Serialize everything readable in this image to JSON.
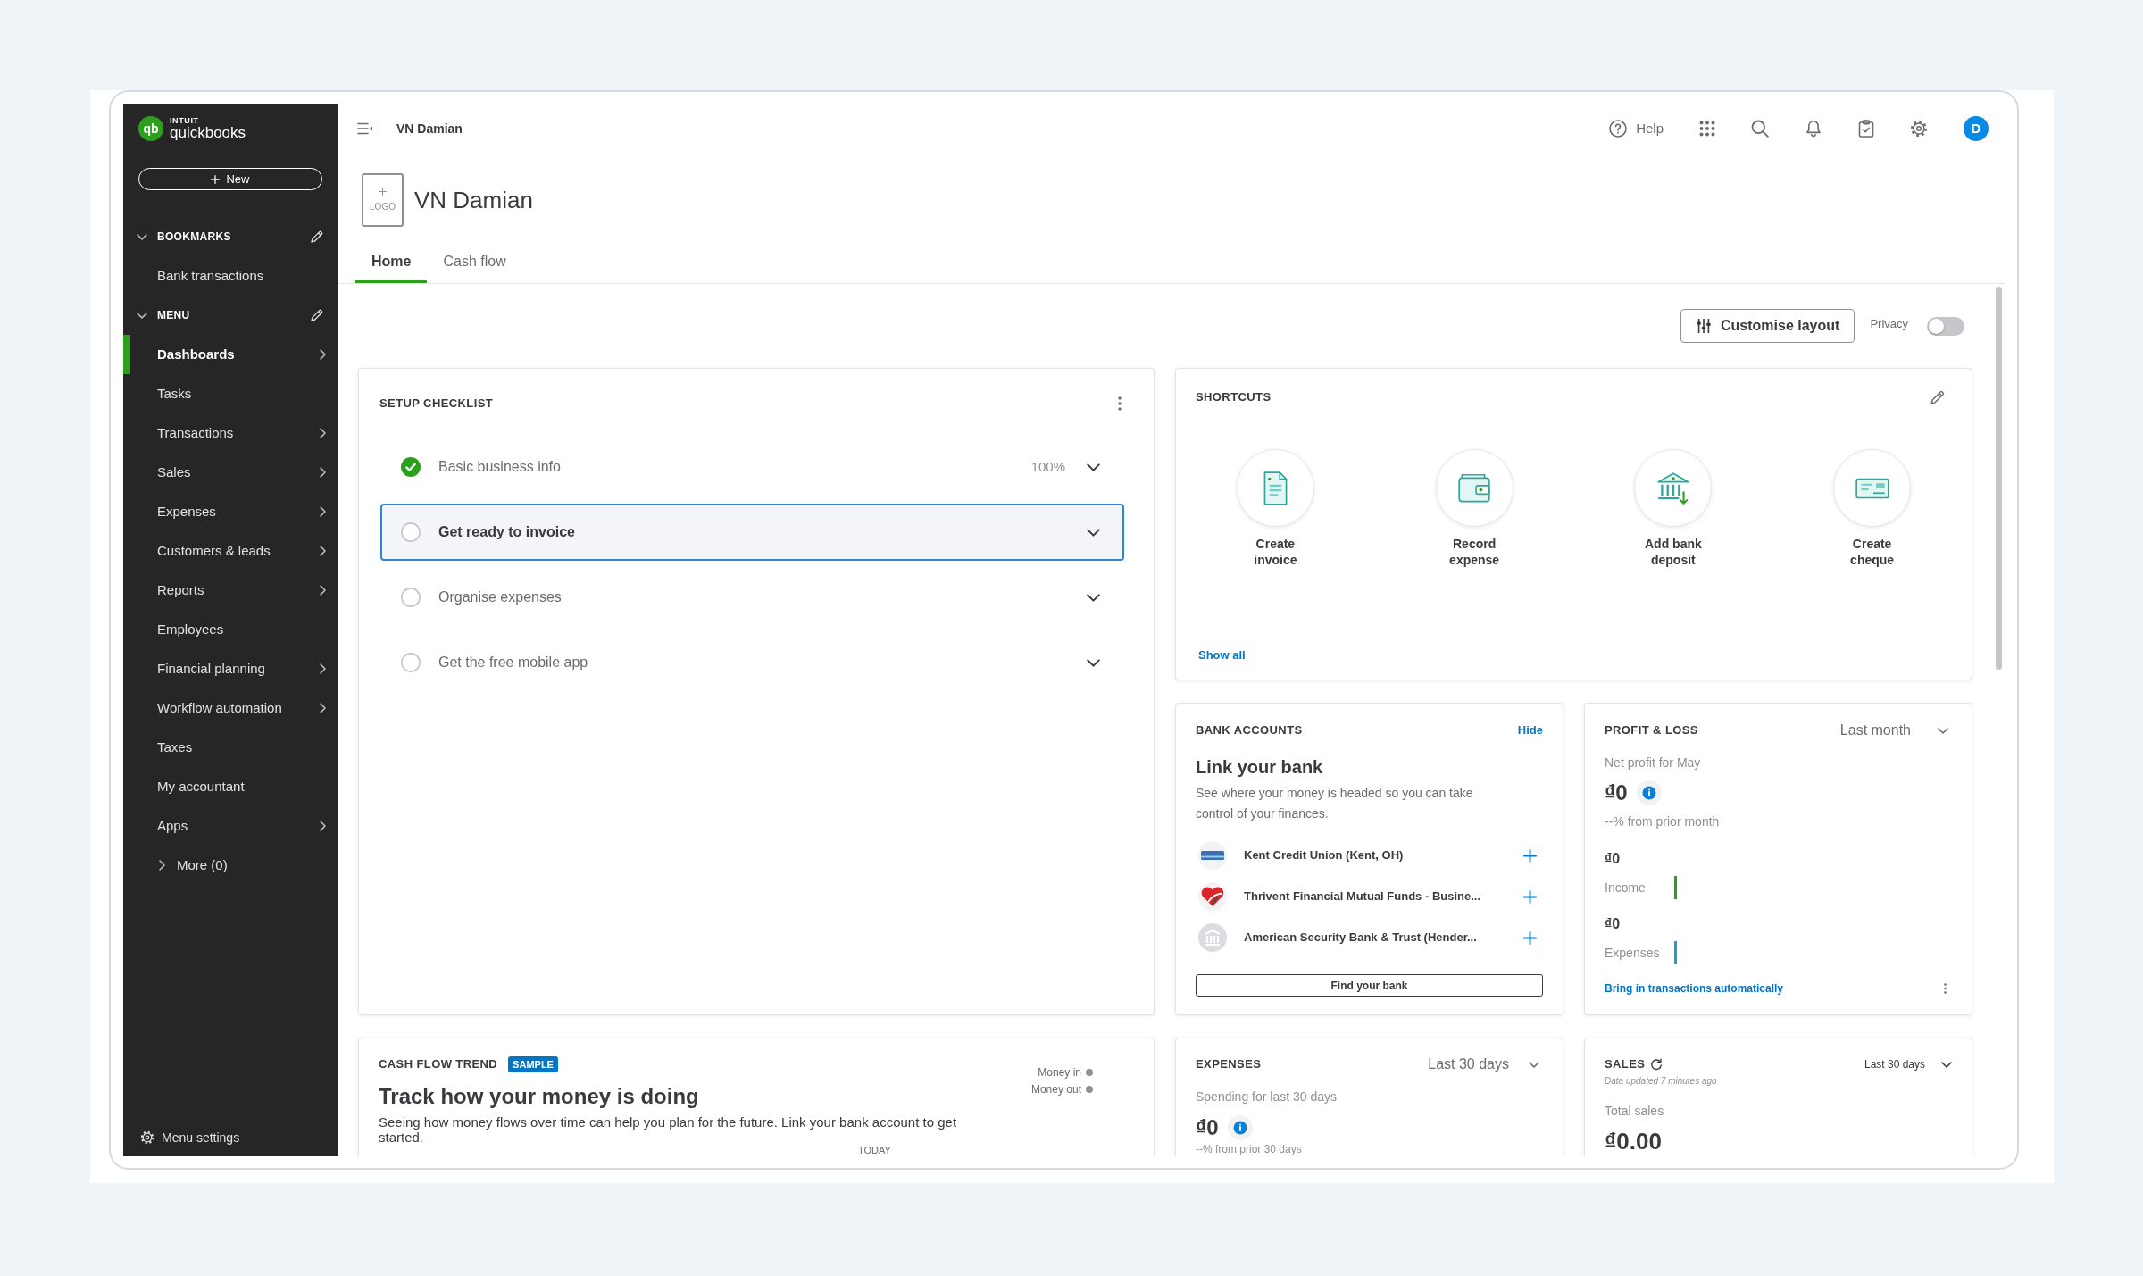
{
  "sidebar": {
    "brand": {
      "mark": "qb",
      "company": "INTUIT",
      "product": "quickbooks"
    },
    "new_button": "New",
    "sections": [
      {
        "label": "BOOKMARKS",
        "expanded": true,
        "items": [
          {
            "label": "Bank transactions",
            "selected": false,
            "submenu": false
          }
        ]
      },
      {
        "label": "MENU",
        "expanded": true,
        "items": [
          {
            "label": "Dashboards",
            "selected": true,
            "submenu": true
          },
          {
            "label": "Tasks",
            "selected": false,
            "submenu": false
          },
          {
            "label": "Transactions",
            "selected": false,
            "submenu": true
          },
          {
            "label": "Sales",
            "selected": false,
            "submenu": true
          },
          {
            "label": "Expenses",
            "selected": false,
            "submenu": true
          },
          {
            "label": "Customers & leads",
            "selected": false,
            "submenu": true
          },
          {
            "label": "Reports",
            "selected": false,
            "submenu": true
          },
          {
            "label": "Employees",
            "selected": false,
            "submenu": false
          },
          {
            "label": "Financial planning",
            "selected": false,
            "submenu": true
          },
          {
            "label": "Workflow automation",
            "selected": false,
            "submenu": true
          },
          {
            "label": "Taxes",
            "selected": false,
            "submenu": false
          },
          {
            "label": "My accountant",
            "selected": false,
            "submenu": false
          },
          {
            "label": "Apps",
            "selected": false,
            "submenu": true
          }
        ]
      }
    ],
    "more": {
      "label": "More (0)",
      "expanded": false
    },
    "settings": "Menu settings"
  },
  "header": {
    "company": "VN Damian",
    "help": "Help",
    "avatar": "D"
  },
  "page": {
    "logo_button": "LOGO",
    "title": "VN Damian",
    "tabs": [
      {
        "label": "Home",
        "selected": true
      },
      {
        "label": "Cash flow",
        "selected": false
      }
    ]
  },
  "toolbar": {
    "customise_button": "Customise layout",
    "privacy": {
      "label": "Privacy",
      "on": false
    }
  },
  "setup_checklist": {
    "title": "SETUP CHECKLIST",
    "items": [
      {
        "label": "Basic business info",
        "checked": true,
        "progress": "100%",
        "selected": false
      },
      {
        "label": "Get ready to invoice",
        "checked": false,
        "selected": true
      },
      {
        "label": "Organise expenses",
        "checked": false,
        "selected": false
      },
      {
        "label": "Get the free mobile app",
        "checked": false,
        "selected": false
      }
    ]
  },
  "shortcuts": {
    "title": "SHORTCUTS",
    "items": [
      {
        "label": "Create invoice",
        "kind": "invoice"
      },
      {
        "label": "Record expense",
        "kind": "expense"
      },
      {
        "label": "Add bank deposit",
        "kind": "deposit"
      },
      {
        "label": "Create cheque",
        "kind": "cheque"
      }
    ],
    "show_all": "Show all"
  },
  "bank_accounts": {
    "title": "BANK ACCOUNTS",
    "hide": "Hide",
    "heading": "Link your bank",
    "description": "See where your money is headed so you can take control of your finances.",
    "banks": [
      {
        "name": "Kent Credit Union (Kent, OH)",
        "kind": "card"
      },
      {
        "name": "Thrivent Financial Mutual Funds - Busine...",
        "kind": "heart"
      },
      {
        "name": "American Security Bank & Trust (Hender...",
        "kind": "generic"
      }
    ],
    "find_button": "Find your bank"
  },
  "profit_loss": {
    "title": "PROFIT & LOSS",
    "period": "Last month",
    "net_label": "Net profit for May",
    "net_value": "₫0",
    "change": "--% from prior month",
    "rows": [
      {
        "value": "₫0",
        "label": "Income",
        "color": "#2ca01c"
      },
      {
        "value": "₫0",
        "label": "Expenses",
        "color": "#1ea0c8"
      }
    ],
    "link": "Bring in transactions automatically"
  },
  "cash_flow": {
    "title": "CASH FLOW TREND",
    "badge": "SAMPLE",
    "heading": "Track how your money is doing",
    "description": "Seeing how money flows over time can help you plan for the future. Link your bank account to get started.",
    "legend": [
      "Money in",
      "Money out"
    ],
    "axis_label": "TODAY"
  },
  "expenses": {
    "title": "EXPENSES",
    "period": "Last 30 days",
    "label": "Spending for last 30 days",
    "value": "₫0",
    "change": "--% from prior 30 days"
  },
  "sales": {
    "title": "SALES",
    "period": "Last 30 days",
    "updated": "Data updated 7 minutes ago",
    "label": "Total sales",
    "value": "₫0.00"
  }
}
